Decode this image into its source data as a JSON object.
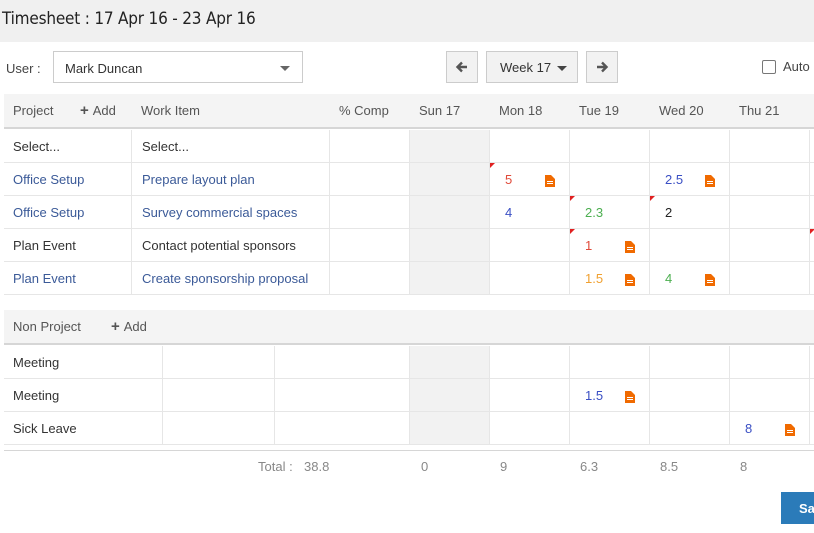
{
  "title": "Timesheet : 17 Apr 16 - 23 Apr 16",
  "user": {
    "label": "User :",
    "value": "Mark Duncan"
  },
  "week": {
    "value": "Week 17"
  },
  "auto": {
    "label": "Auto"
  },
  "project_header": {
    "project": "Project",
    "add": "Add",
    "work_item": "Work Item",
    "pct": "% Comp",
    "days": [
      "Sun 17",
      "Mon 18",
      "Tue 19",
      "Wed 20",
      "Thu 21"
    ]
  },
  "select_row": {
    "project": "Select...",
    "work_item": "Select..."
  },
  "project_rows": [
    {
      "project": "Office Setup",
      "work_item": "Prepare layout plan",
      "link": true
    },
    {
      "project": "Office Setup",
      "work_item": "Survey commercial spaces",
      "link": true
    },
    {
      "project": "Plan Event",
      "work_item": "Contact potential sponsors",
      "link": false
    },
    {
      "project": "Plan Event",
      "work_item": "Create sponsorship proposal",
      "link": true
    }
  ],
  "project_hours": [
    {
      "mon": "5",
      "wed": "2.5"
    },
    {
      "mon": "4",
      "tue": "2.3",
      "wed": "2"
    },
    {
      "tue": "1"
    },
    {
      "tue": "1.5",
      "wed": "4"
    }
  ],
  "non_project_header": {
    "label": "Non Project",
    "add": "Add"
  },
  "non_project_rows": [
    {
      "label": "Meeting"
    },
    {
      "label": "Meeting"
    },
    {
      "label": "Sick Leave"
    }
  ],
  "non_project_hours": [
    {},
    {
      "tue": "1.5"
    },
    {
      "thu": "8"
    }
  ],
  "totals": {
    "label": "Total :",
    "total": "38.8",
    "days": [
      "0",
      "9",
      "6.3",
      "8.5",
      "8"
    ]
  },
  "save_label": "Save",
  "colors": {
    "red": "#e04a3a",
    "blue": "#3a4fc4",
    "green": "#4caf50",
    "orange": "#f0a030",
    "doc_icon": "#f06a00"
  }
}
